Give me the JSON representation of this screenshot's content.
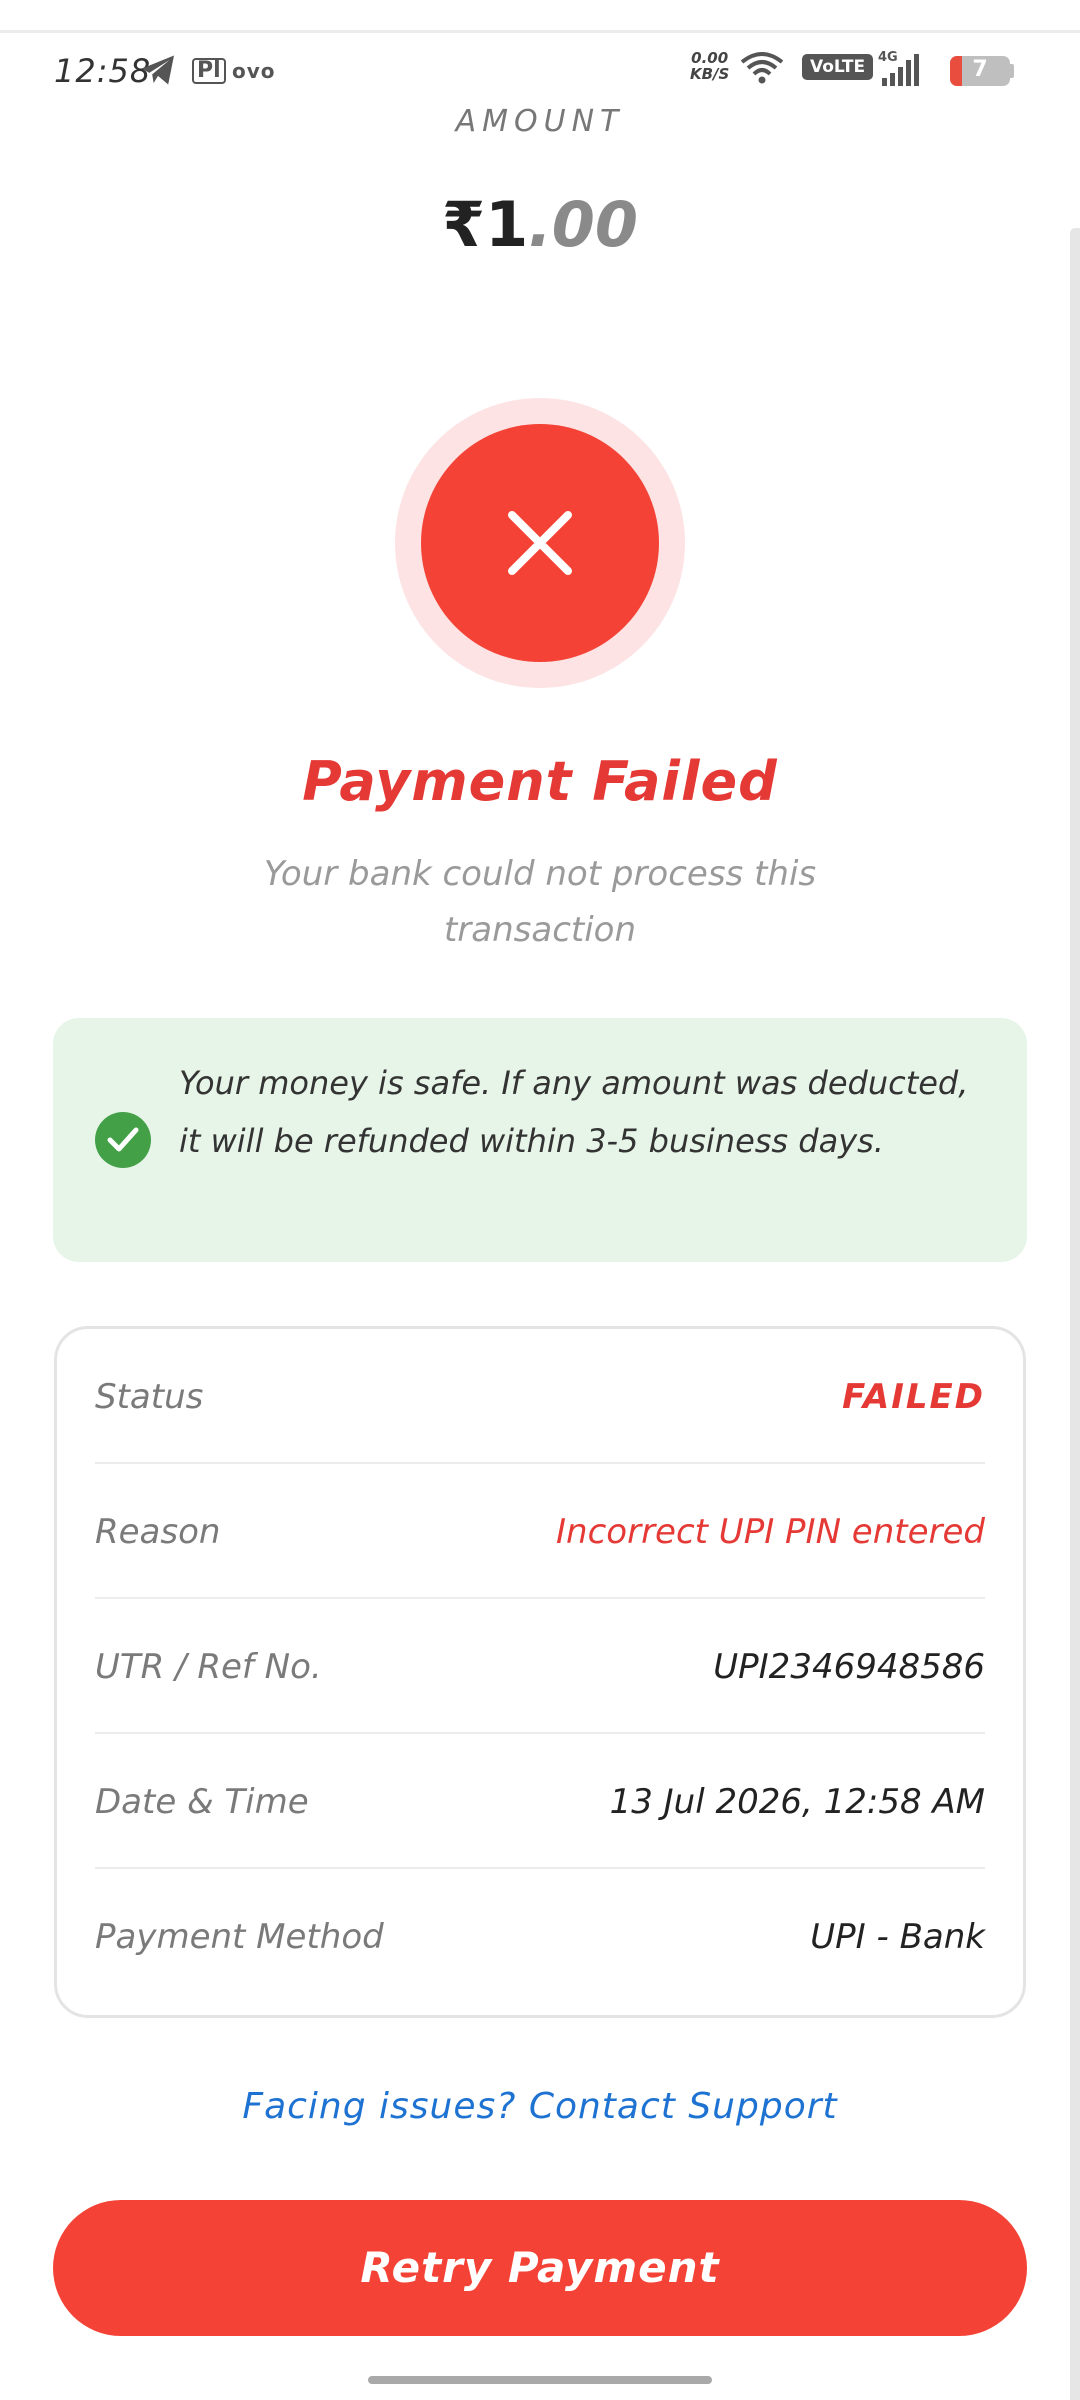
{
  "status_bar": {
    "time": "12:58",
    "speed_value": "0.00",
    "speed_unit": "KB/S",
    "volte": "VoLTE",
    "network": "4G",
    "battery": "7",
    "pl_label": "Pl",
    "ovo_label": "ovo"
  },
  "amount": {
    "label": "AMOUNT",
    "currency": "₹",
    "whole": "1",
    "decimal": ".00"
  },
  "result": {
    "title": "Payment Failed",
    "subtitle": "Your bank could not process this transaction"
  },
  "notice": {
    "text": "Your money is safe. If any amount was deducted, it will be refunded within 3-5 business days."
  },
  "details": [
    {
      "label": "Status",
      "value": "FAILED"
    },
    {
      "label": "Reason",
      "value": "Incorrect UPI PIN entered"
    },
    {
      "label": "UTR / Ref No.",
      "value": "UPI2346948586"
    },
    {
      "label": "Date & Time",
      "value": "13 Jul 2026, 12:58 AM"
    },
    {
      "label": "Payment Method",
      "value": "UPI - Bank"
    }
  ],
  "support_link": "Facing issues? Contact Support",
  "retry_button": "Retry Payment",
  "colors": {
    "danger": "#f44336",
    "success": "#43a047",
    "link": "#1e73d2"
  }
}
